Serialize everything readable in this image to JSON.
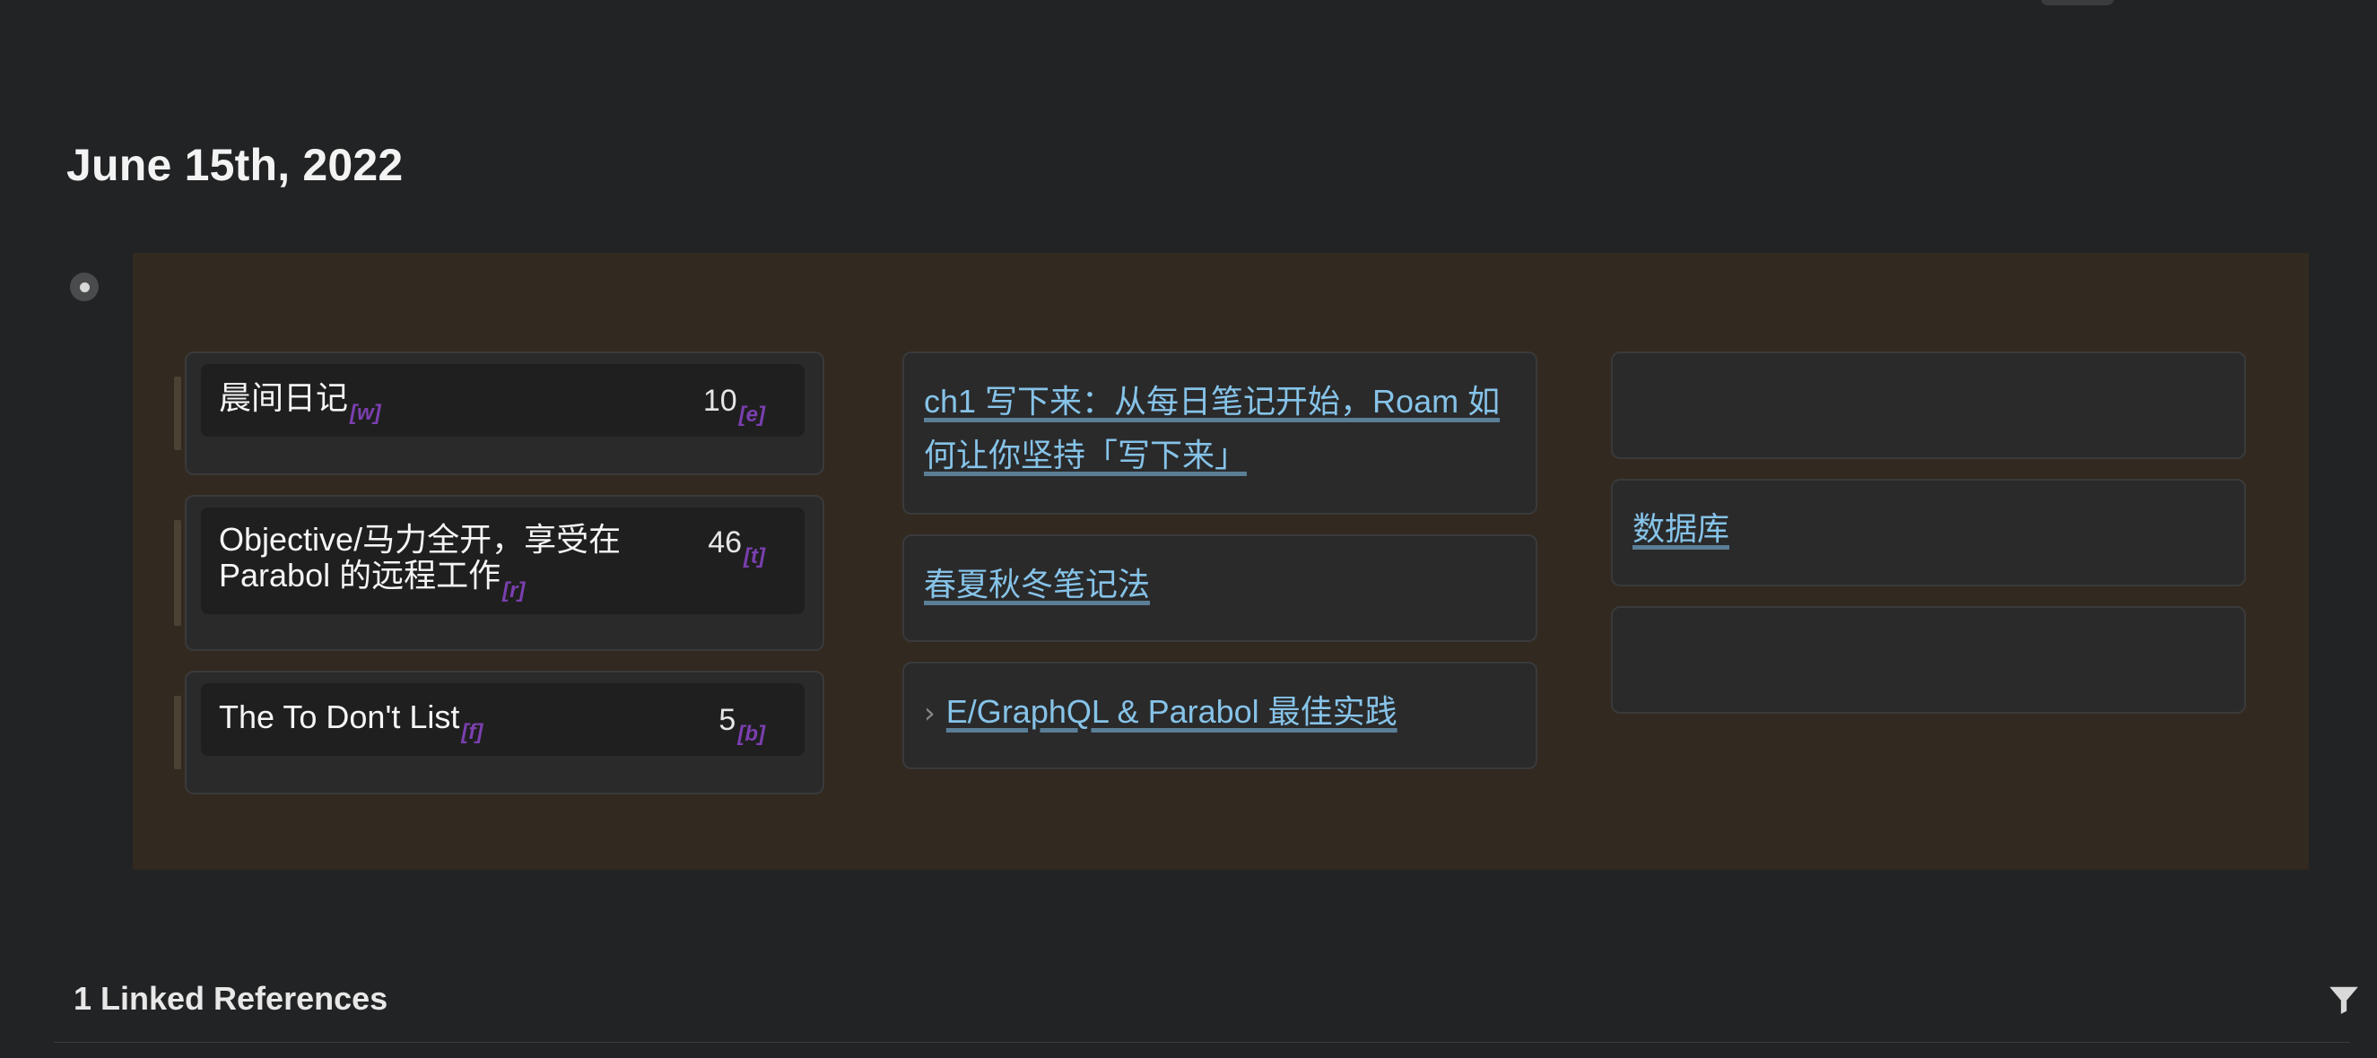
{
  "page": {
    "title": "June 15th, 2022"
  },
  "board": {
    "todo_cards": [
      {
        "title": "晨间日记",
        "title_hint": "[w]",
        "count": "10",
        "count_hint": "[e]"
      },
      {
        "title": "Objective/马力全开，享受在 Parabol 的远程工作",
        "title_hint": "[r]",
        "count": "46",
        "count_hint": "[t]"
      },
      {
        "title": "The To Don't List",
        "title_hint": "[f]",
        "count": "5",
        "count_hint": "[b]"
      }
    ],
    "link_cards": [
      {
        "label": "ch1 写下来：从每日笔记开始，Roam 如何让你坚持「写下来」"
      },
      {
        "label": "春夏秋冬笔记法"
      },
      {
        "arrow": "›",
        "label": "E/GraphQL & Parabol 最佳实践"
      }
    ],
    "right_cards": [
      {
        "label": ""
      },
      {
        "label": "数据库"
      },
      {
        "label": ""
      }
    ]
  },
  "references": {
    "title": "1 Linked References",
    "filter_icon": "filter-icon"
  },
  "colors": {
    "background": "#222324",
    "board": "#322920",
    "link": "#86c3e8",
    "hint": "#7b3fb0"
  }
}
